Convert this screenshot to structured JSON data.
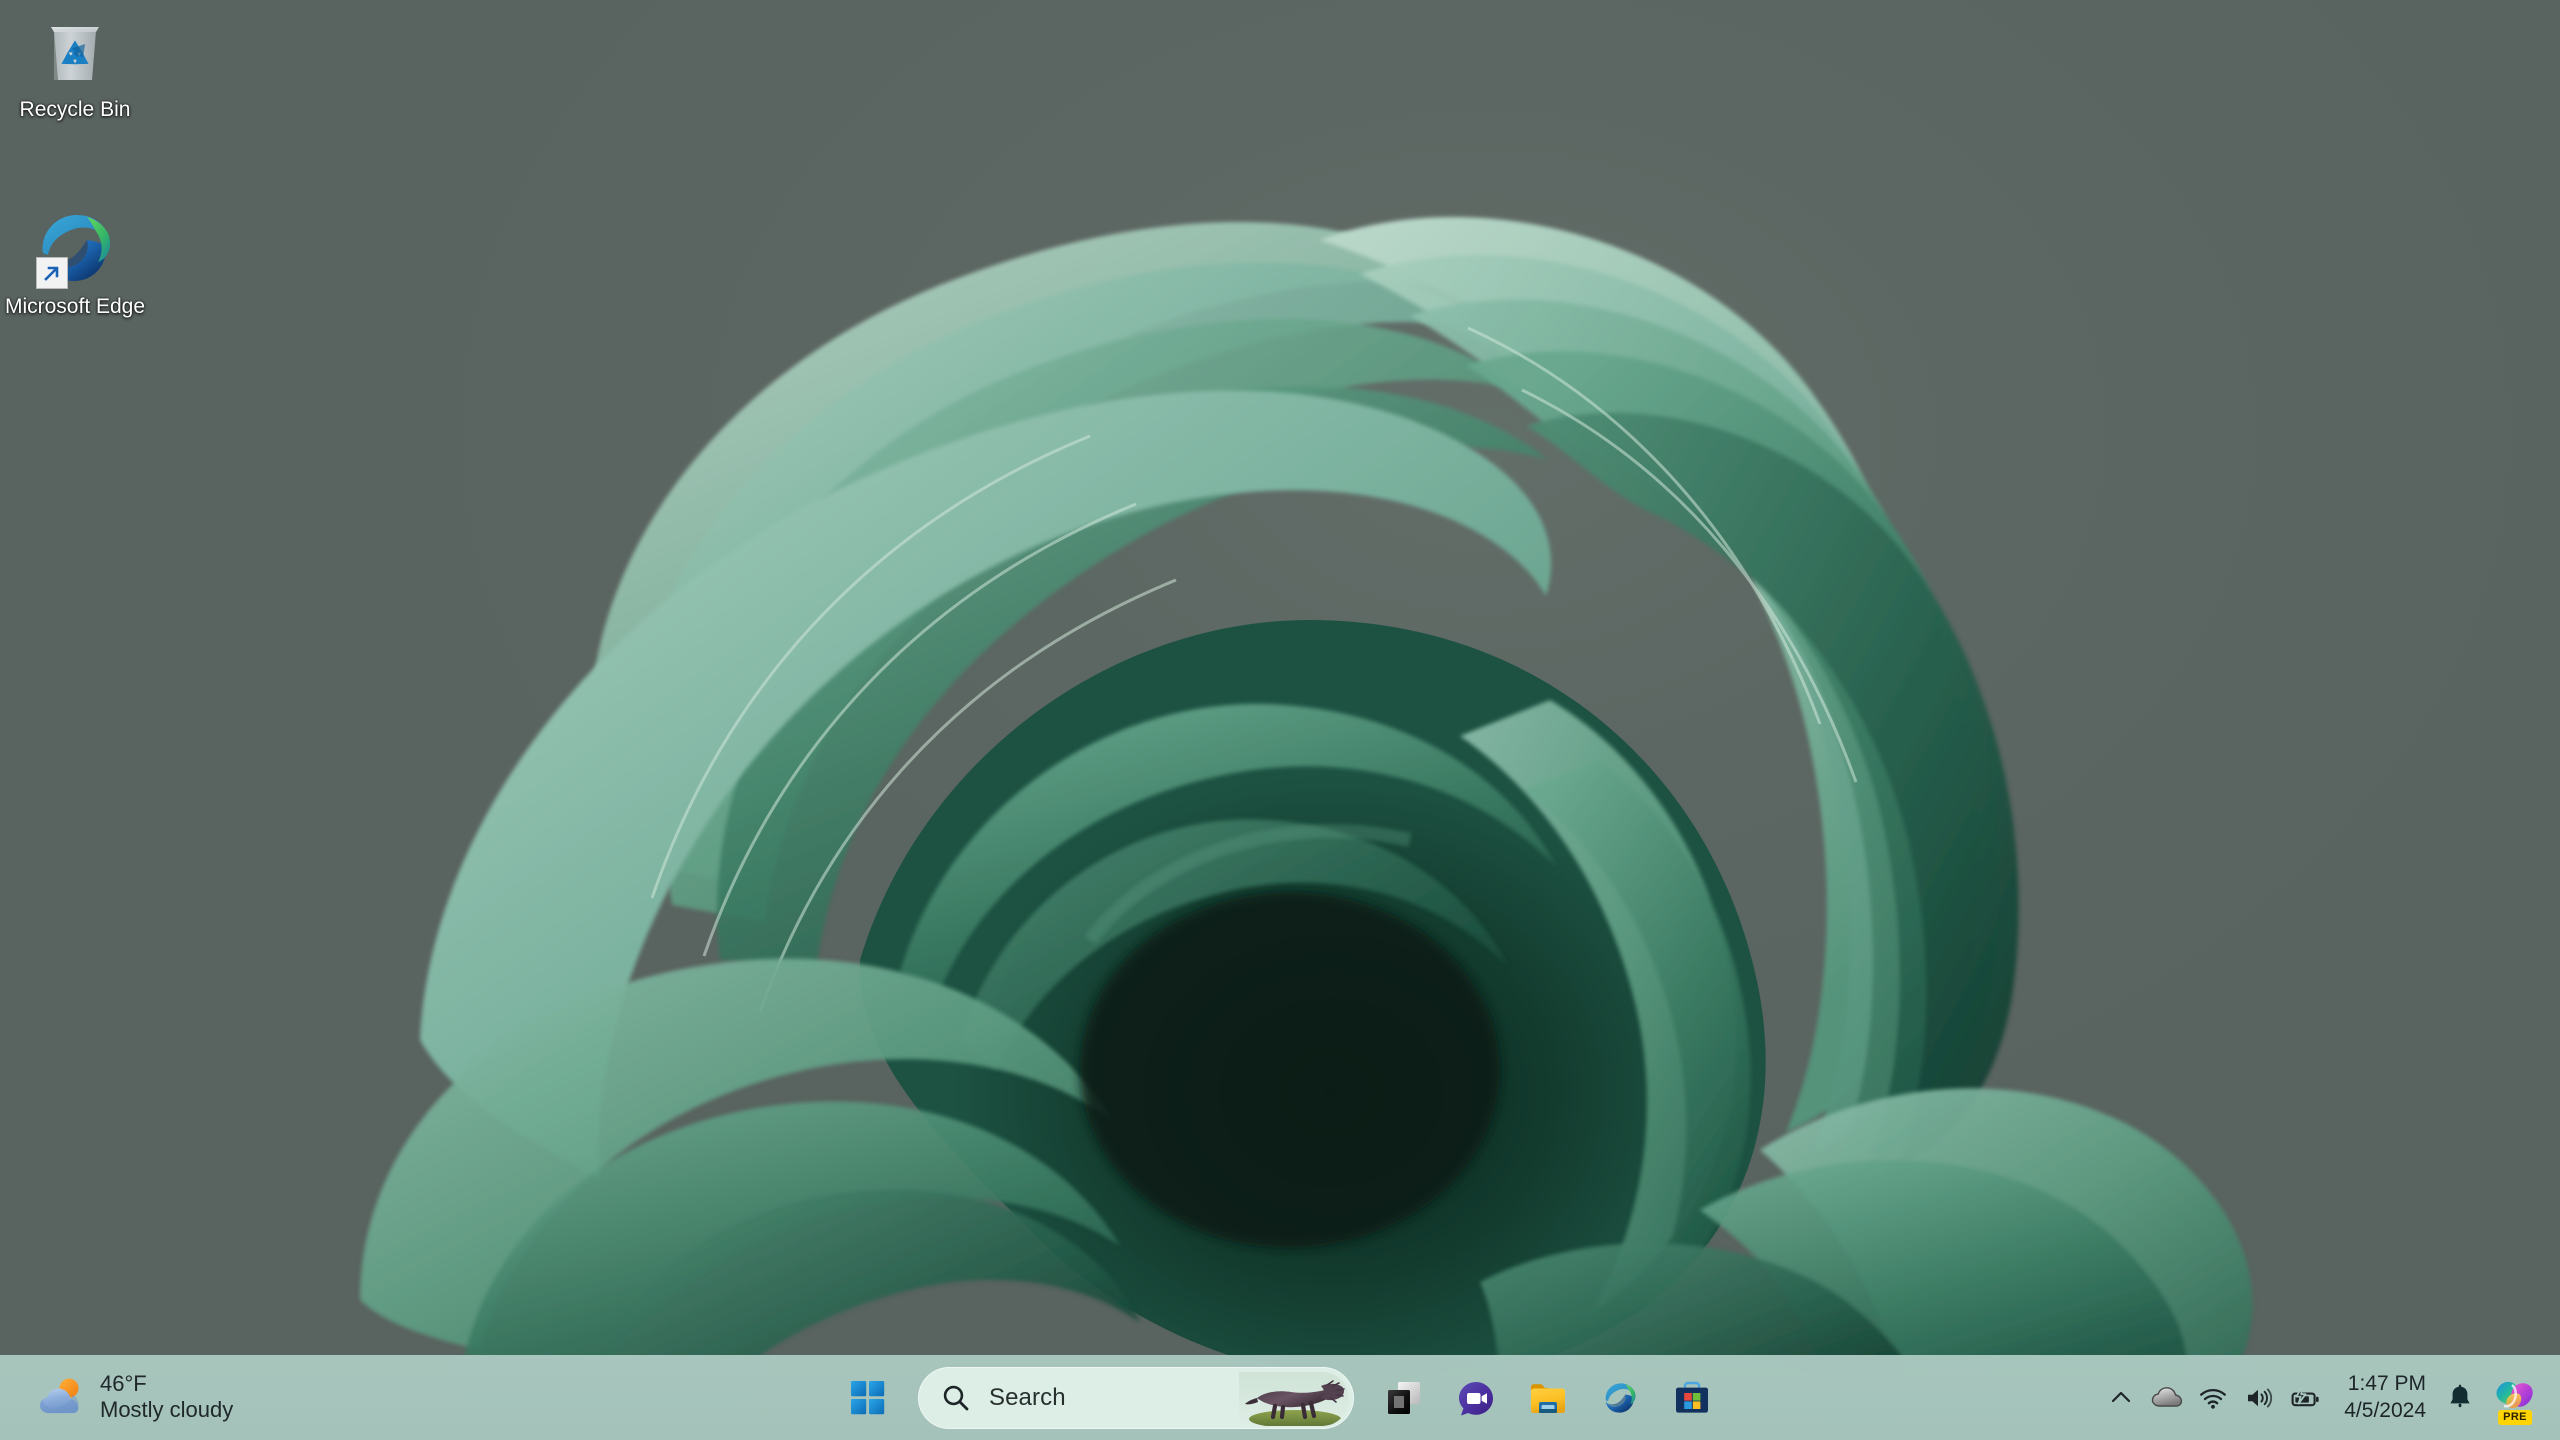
{
  "desktop": {
    "wallpaper_name": "windows-11-bloom-green",
    "background_color": "#5b6561",
    "icons": [
      {
        "label": "Recycle Bin",
        "icon": "recycle-bin-icon",
        "shortcut": false
      },
      {
        "label": "Microsoft Edge",
        "icon": "microsoft-edge-icon",
        "shortcut": true
      }
    ]
  },
  "taskbar": {
    "background_color": "#a8c7be",
    "weather": {
      "temperature": "46°F",
      "condition": "Mostly cloudy",
      "icon": "sun-behind-cloud-icon"
    },
    "start": {
      "label": "Start",
      "icon": "windows-logo-icon"
    },
    "search": {
      "placeholder": "Search",
      "value": "",
      "icon": "search-icon",
      "bing_image": "anteater-photo"
    },
    "apps": [
      {
        "label": "Task View",
        "icon": "task-view-icon"
      },
      {
        "label": "Chat",
        "icon": "chat-video-icon"
      },
      {
        "label": "File Explorer",
        "icon": "file-explorer-icon"
      },
      {
        "label": "Microsoft Edge",
        "icon": "microsoft-edge-icon"
      },
      {
        "label": "Microsoft Store",
        "icon": "microsoft-store-icon"
      }
    ],
    "tray": {
      "overflow": {
        "label": "Show hidden icons",
        "icon": "chevron-up-icon"
      },
      "icons": [
        {
          "label": "OneDrive",
          "icon": "onedrive-cloud-icon"
        },
        {
          "label": "Network",
          "icon": "wifi-icon"
        },
        {
          "label": "Volume",
          "icon": "speaker-icon"
        },
        {
          "label": "Battery charging",
          "icon": "battery-charging-icon"
        }
      ],
      "clock": {
        "time": "1:47 PM",
        "date": "4/5/2024"
      },
      "notifications": {
        "label": "Notifications",
        "icon": "bell-icon"
      },
      "copilot": {
        "label": "Copilot",
        "icon": "copilot-icon",
        "badge": "PRE"
      }
    }
  },
  "colors": {
    "taskbar": "#a8c7be",
    "search_pill": "#e1f1ea",
    "bloom_light": "#8fbca9",
    "bloom_mid": "#4e8f74",
    "bloom_dark": "#1f4a3c",
    "bloom_core": "#0d2b22",
    "text_dark": "#1d2528",
    "badge_yellow": "#ffd400"
  }
}
